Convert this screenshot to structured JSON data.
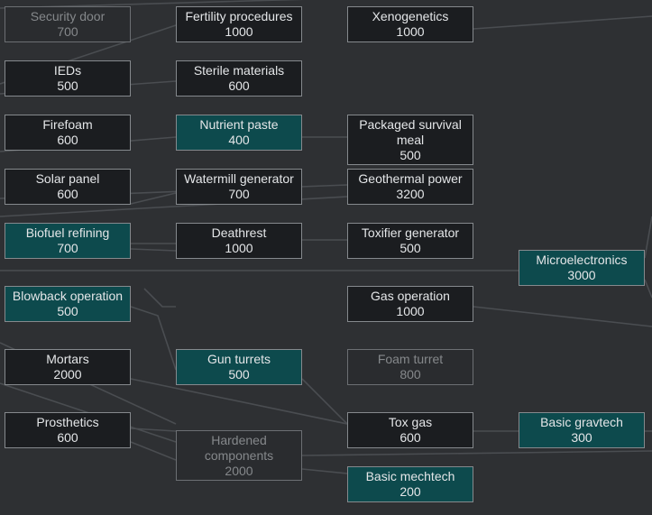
{
  "nodes": [
    {
      "id": "security-door",
      "name": "Security door",
      "cost": "700",
      "state": "locked"
    },
    {
      "id": "ieds",
      "name": "IEDs",
      "cost": "500",
      "state": "available"
    },
    {
      "id": "firefoam",
      "name": "Firefoam",
      "cost": "600",
      "state": "available"
    },
    {
      "id": "solar-panel",
      "name": "Solar panel",
      "cost": "600",
      "state": "available"
    },
    {
      "id": "biofuel-refining",
      "name": "Biofuel refining",
      "cost": "700",
      "state": "researched"
    },
    {
      "id": "blowback-operation",
      "name": "Blowback operation",
      "cost": "500",
      "state": "researched"
    },
    {
      "id": "mortars",
      "name": "Mortars",
      "cost": "2000",
      "state": "available"
    },
    {
      "id": "prosthetics",
      "name": "Prosthetics",
      "cost": "600",
      "state": "available"
    },
    {
      "id": "fertility-procedures",
      "name": "Fertility procedures",
      "cost": "1000",
      "state": "available"
    },
    {
      "id": "sterile-materials",
      "name": "Sterile materials",
      "cost": "600",
      "state": "available"
    },
    {
      "id": "nutrient-paste",
      "name": "Nutrient paste",
      "cost": "400",
      "state": "researched"
    },
    {
      "id": "watermill-generator",
      "name": "Watermill generator",
      "cost": "700",
      "state": "available"
    },
    {
      "id": "deathrest",
      "name": "Deathrest",
      "cost": "1000",
      "state": "available"
    },
    {
      "id": "gun-turrets",
      "name": "Gun turrets",
      "cost": "500",
      "state": "researched"
    },
    {
      "id": "hardened-components",
      "name": "Hardened components",
      "cost": "2000",
      "state": "locked"
    },
    {
      "id": "xenogenetics",
      "name": "Xenogenetics",
      "cost": "1000",
      "state": "available"
    },
    {
      "id": "packaged-survival-meal",
      "name": "Packaged survival meal",
      "cost": "500",
      "state": "available"
    },
    {
      "id": "geothermal-power",
      "name": "Geothermal power",
      "cost": "3200",
      "state": "available"
    },
    {
      "id": "toxifier-generator",
      "name": "Toxifier generator",
      "cost": "500",
      "state": "available"
    },
    {
      "id": "gas-operation",
      "name": "Gas operation",
      "cost": "1000",
      "state": "available"
    },
    {
      "id": "foam-turret",
      "name": "Foam turret",
      "cost": "800",
      "state": "locked"
    },
    {
      "id": "tox-gas",
      "name": "Tox gas",
      "cost": "600",
      "state": "available"
    },
    {
      "id": "basic-mechtech",
      "name": "Basic mechtech",
      "cost": "200",
      "state": "researched"
    },
    {
      "id": "microelectronics",
      "name": "Microelectronics",
      "cost": "3000",
      "state": "researched"
    },
    {
      "id": "basic-gravtech",
      "name": "Basic gravtech",
      "cost": "300",
      "state": "researched"
    }
  ]
}
